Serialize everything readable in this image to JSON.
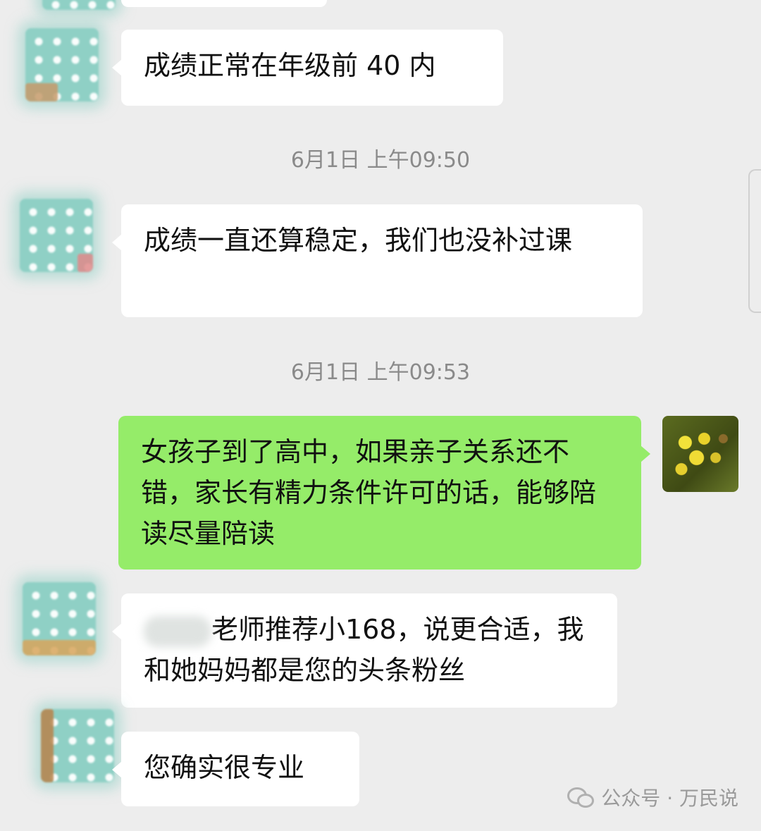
{
  "messages": [
    {
      "type": "incoming",
      "text": "成绩正常在年级前 40 内"
    },
    {
      "type": "time",
      "text": "6月1日 上午09:50"
    },
    {
      "type": "incoming",
      "text": "成绩一直还算稳定，我们也没补过课"
    },
    {
      "type": "time",
      "text": "6月1日 上午09:53"
    },
    {
      "type": "outgoing",
      "text": "女孩子到了高中，如果亲子关系还不错，家长有精力条件许可的话，能够陪读尽量陪读"
    },
    {
      "type": "incoming",
      "text": "老师推荐小168，说更合适，我和她妈妈都是您的头条粉丝"
    },
    {
      "type": "incoming",
      "text": "您确实很专业"
    }
  ],
  "watermark": "公众号 · 万民说",
  "colors": {
    "background": "#ededed",
    "incoming_bubble": "#ffffff",
    "outgoing_bubble": "#95ec69",
    "timestamp": "#8a8a8a"
  },
  "icons": [
    "blurred-avatar",
    "rapeseed-flower-avatar",
    "wechat-icon"
  ]
}
